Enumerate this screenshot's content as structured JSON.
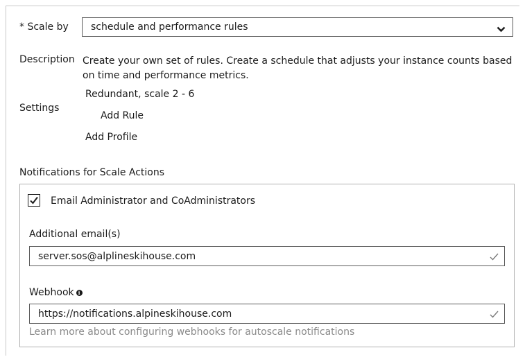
{
  "scale": {
    "label": "* Scale by",
    "selected": "schedule and performance rules"
  },
  "description": {
    "label": "Description",
    "text": "Create your own set of rules. Create a schedule that adjusts your instance counts based on time and performance metrics."
  },
  "settings": {
    "label": "Settings",
    "profile_summary": "Redundant, scale 2 - 6",
    "add_rule": "Add Rule",
    "add_profile": "Add Profile"
  },
  "notifications": {
    "heading": "Notifications for Scale Actions",
    "email_admins_label": "Email Administrator and CoAdministrators",
    "email_admins_checked": true,
    "additional_emails_label": "Additional email(s)",
    "additional_emails_value": "server.sos@alplineskihouse.com",
    "webhook_label": "Webhook",
    "webhook_value": "https://notifications.alpineskihouse.com",
    "learn_more": "Learn more about configuring webhooks for autoscale notifications"
  },
  "icons": {
    "dropdown": "chevron-down-icon",
    "valid": "checkmark-icon",
    "info": "info-icon"
  },
  "colors": {
    "border": "#5a5a5a",
    "muted_text": "#8a8a8a",
    "valid_check": "#7a7a7a"
  }
}
